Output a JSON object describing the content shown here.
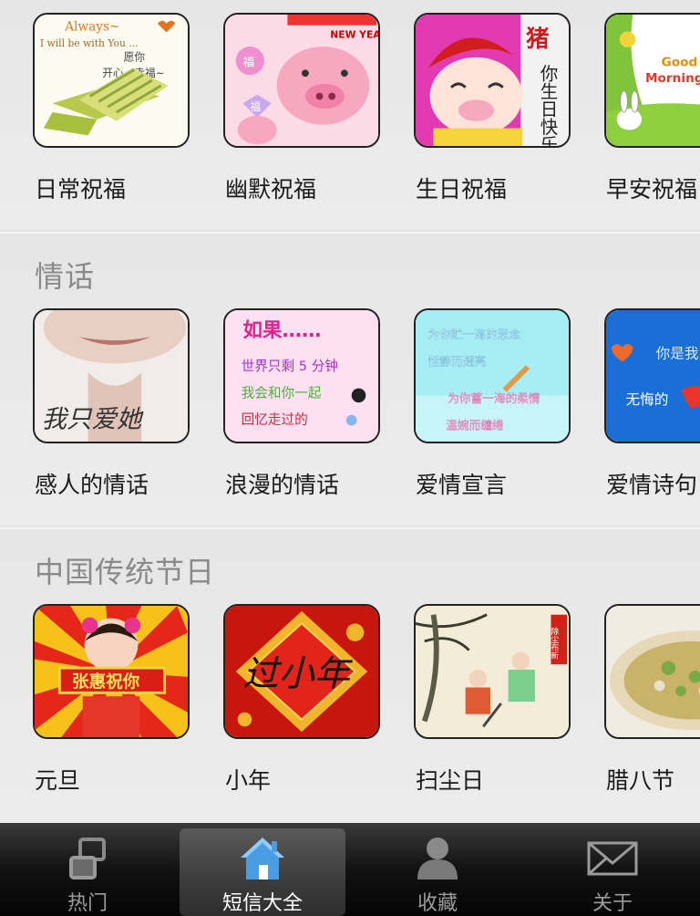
{
  "sections": [
    {
      "title": "",
      "items": [
        {
          "label": "日常祝福",
          "thumb_text": [
            "Always~",
            "I will be with You ...",
            "愿你",
            "开心、幸福~"
          ]
        },
        {
          "label": "幽默祝福",
          "thumb_text": [
            "NEW YEAR",
            "福",
            "福"
          ]
        },
        {
          "label": "生日祝福",
          "thumb_text": [
            "猪",
            "你生日快乐"
          ]
        },
        {
          "label": "早安祝福",
          "thumb_text": [
            "Good",
            "Morning"
          ]
        }
      ]
    },
    {
      "title": "情话",
      "items": [
        {
          "label": "感人的情话",
          "thumb_text": [
            "我只爱她"
          ]
        },
        {
          "label": "浪漫的情话",
          "thumb_text": [
            "如果……",
            "世界只剩 5 分钟",
            "我会和你一起",
            "回忆走过的"
          ]
        },
        {
          "label": "爱情宣言",
          "thumb_text": [
            "为你贮一海的思念",
            "恬静而透亮",
            "为你蓄一海的柔情",
            "温婉而缱绻"
          ]
        },
        {
          "label": "爱情诗句",
          "thumb_text": [
            "你是我",
            "无悔的"
          ]
        }
      ]
    },
    {
      "title": "中国传统节日",
      "items": [
        {
          "label": "元旦",
          "thumb_text": [
            "张惠祝你"
          ]
        },
        {
          "label": "小年",
          "thumb_text": [
            "过小年"
          ]
        },
        {
          "label": "扫尘日",
          "thumb_text": [
            "除尘布新"
          ]
        },
        {
          "label": "腊八节",
          "thumb_text": []
        }
      ]
    }
  ],
  "tabs": [
    {
      "label": "热门",
      "icon": "windows-icon",
      "active": false
    },
    {
      "label": "短信大全",
      "icon": "home-icon",
      "active": true
    },
    {
      "label": "收藏",
      "icon": "person-icon",
      "active": false
    },
    {
      "label": "关于",
      "icon": "envelope-icon",
      "active": false
    }
  ],
  "colors": {
    "active_tab_icon": "#4a9de0",
    "tab_bar": "#0d0d0d",
    "section_bg": "#e8e8e8"
  }
}
